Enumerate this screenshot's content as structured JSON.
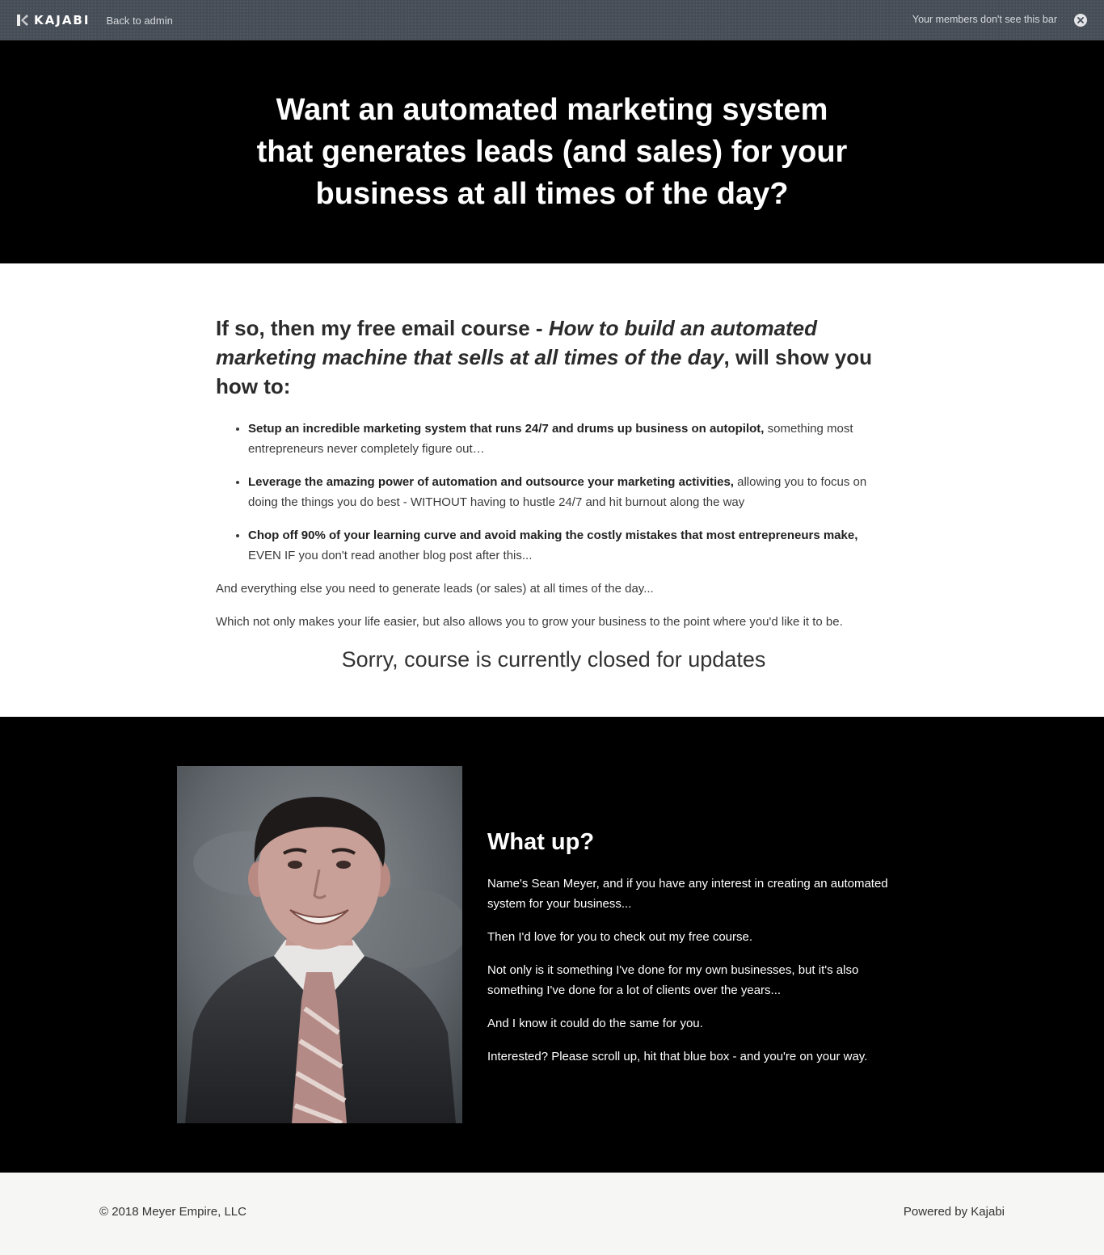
{
  "admin_bar": {
    "brand": "KAJABI",
    "back_link": "Back to admin",
    "note": "Your members don't see this bar",
    "close_icon": "close-circle-icon"
  },
  "hero": {
    "title_lines": [
      "Want an automated marketing system",
      "that generates leads (and sales) for your",
      "business at all times of the day?"
    ]
  },
  "intro": {
    "headline_start": "If so, then my free email course - ",
    "headline_course": "How to build an automated marketing machine that sells at all times of the day",
    "headline_end": ", will show you how to:",
    "benefits": [
      {
        "bold": "Setup an incredible marketing system that runs 24/7 and drums up business on autopilot,",
        "rest": " something most entrepreneurs never completely figure out…"
      },
      {
        "bold": "Leverage the amazing power of automation and outsource your marketing activities,",
        "rest": " allowing you to focus on doing the things you do best - WITHOUT having to hustle 24/7 and hit burnout along the way"
      },
      {
        "bold": "Chop off 90% of your learning curve and avoid making the costly mistakes that most entrepreneurs make,",
        "rest": " EVEN IF you don't read another blog post after this..."
      }
    ],
    "paragraphs": [
      "And everything else you need to generate leads (or sales) at all times of the day...",
      "Which not only makes your life easier, but also allows you to grow your business to the point where you'd like it to be."
    ],
    "closed_note": "Sorry, course is currently closed for updates"
  },
  "about": {
    "photo": "portrait-photo",
    "title": "What up?",
    "paragraphs": [
      "Name's Sean Meyer, and if you have any interest in creating an automated system for your business...",
      "Then I'd love for you to check out my free course.",
      "Not only is it something I've done for my own businesses, but it's also something I've done for a lot of clients over the years...",
      "And I know it could do the same for you.",
      "Interested? Please scroll up, hit that blue box - and you're on your way."
    ]
  },
  "footer": {
    "copyright": "© 2018 Meyer Empire, LLC",
    "powered_by": "Powered by Kajabi"
  },
  "colors": {
    "admin_bar": "#474d56",
    "hero_bg": "#000000",
    "footer_bg": "#f6f6f5"
  }
}
